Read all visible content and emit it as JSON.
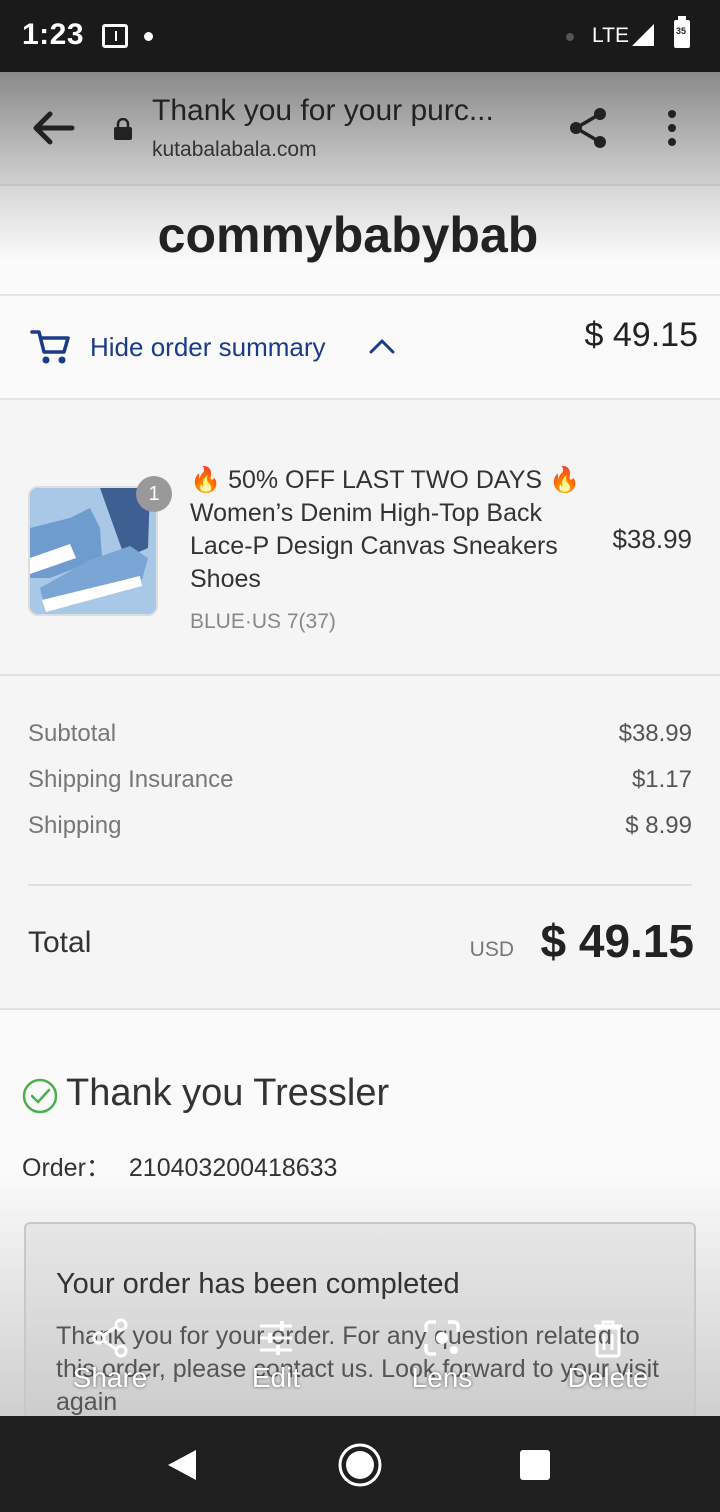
{
  "status_bar": {
    "time": "1:23",
    "network": "LTE",
    "battery_level": "35"
  },
  "browser": {
    "title": "Thank you for your purc...",
    "url": "kutabalabala.com"
  },
  "store": {
    "name": "commybabybab"
  },
  "order_summary": {
    "toggle_label": "Hide order summary",
    "total": "$ 49.15"
  },
  "product": {
    "quantity": "1",
    "title": "🔥 50% OFF LAST TWO DAYS 🔥Women’s Denim High-Top Back Lace-P Design Canvas Sneakers Shoes",
    "variant": "BLUE·US 7(37)",
    "price": "$38.99"
  },
  "costs": {
    "subtotal_label": "Subtotal",
    "subtotal_value": "$38.99",
    "insurance_label": "Shipping Insurance",
    "insurance_value": "$1.17",
    "shipping_label": "Shipping",
    "shipping_value": "$ 8.99",
    "total_label": "Total",
    "total_currency": "USD",
    "total_value": "$ 49.15"
  },
  "confirmation": {
    "title": "Thank you Tressler",
    "order_label": "Order：",
    "order_number": "210403200418633",
    "box_title": "Your order has been completed",
    "box_body": "Thank you for your order. For any question related to this order, please contact us. Look forward to your visit again"
  },
  "viewer_actions": {
    "share": "Share",
    "edit": "Edit",
    "lens": "Lens",
    "delete": "Delete"
  },
  "colors": {
    "link_blue": "#1a3a8a",
    "check_green": "#4caf50"
  }
}
